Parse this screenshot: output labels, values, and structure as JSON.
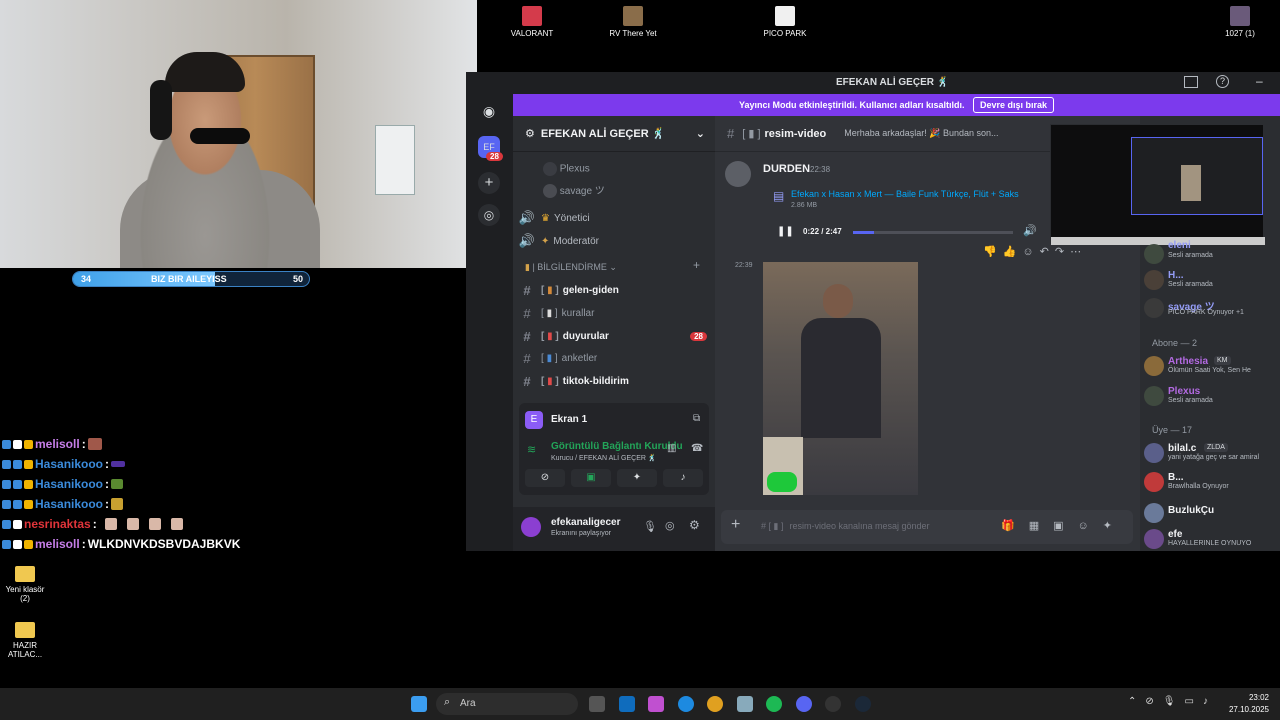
{
  "webcam": {
    "progress": {
      "left": "34",
      "label": "BIZ BIR AILEYISS",
      "right": "50",
      "fill": 0.6
    }
  },
  "desktop_icons_top": [
    {
      "label": "VALORANT",
      "color": "#d43b4b"
    },
    {
      "label": "RV There Yet",
      "color": "#8a6d4a"
    },
    {
      "label": "PICO PARK",
      "color": "#f0f0f0"
    },
    {
      "label": "1027 (1)",
      "color": "#6a5a7a"
    }
  ],
  "desktop_icons_left": [
    {
      "label": "Yeni klasör (2)"
    },
    {
      "label": "HAZIR ATILAC..."
    }
  ],
  "chat_overlay": [
    {
      "user": "melisoll",
      "text": "",
      "color": "#c67ee8"
    },
    {
      "user": "Hasanikooo",
      "text": "",
      "color": "#3b8bdb"
    },
    {
      "user": "Hasanikooo",
      "text": "",
      "color": "#3b8bdb"
    },
    {
      "user": "Hasanikooo",
      "text": "",
      "color": "#3b8bdb"
    },
    {
      "user": "nesrinaktas",
      "text": "",
      "color": "#e0343a"
    },
    {
      "user": "melisoll",
      "text": "WLKDNVKDSBVDAJBKVK",
      "color": "#c67ee8"
    }
  ],
  "discord": {
    "window_title": "EFEKAN ALİ GEÇER 🕺",
    "server_badge": "28",
    "streamer_mode": {
      "text": "Yayıncı Modu etkinleştirildi. Kullanıcı adları kısaltıldı.",
      "button": "Devre dışı bırak"
    },
    "server_name": "EFEKAN ALİ GEÇER 🕺",
    "voice_users": [
      "Plexus",
      "savage ツ"
    ],
    "categories": [
      {
        "label": "Yönetici"
      },
      {
        "label": "Moderatör"
      }
    ],
    "info_category": "| BİLGİLENDİRME",
    "channels": [
      {
        "label": "gelen-giden",
        "bold": true,
        "badge": ""
      },
      {
        "label": "kurallar",
        "bold": false,
        "badge": ""
      },
      {
        "label": "duyurular",
        "bold": true,
        "badge": "28"
      },
      {
        "label": "anketler",
        "bold": false,
        "badge": ""
      },
      {
        "label": "tiktok-bildirim",
        "bold": true,
        "badge": ""
      }
    ],
    "screen_panel": {
      "title": "Ekran 1",
      "status": "Görüntülü Bağlantı Kuruldu",
      "sub": "Kurucu / EFEKAN ALİ GEÇER 🕺"
    },
    "user": {
      "name": "efekanaligecer",
      "status": "Ekranını paylaşıyor"
    },
    "channel_header": {
      "name": "resim-video",
      "topic": "Merhaba arkadaşlar! 🎉 Bundan son..."
    },
    "messages": {
      "author": "DURDEN",
      "time": "22:38",
      "file_name": "Efekan x Hasan x Mert — Baile Funk Türkçe, Flüt + Saks",
      "file_size": "2.86 MB",
      "audio_time": "0:22 / 2:47",
      "audio_progress": 0.13,
      "second_time": "22:39"
    },
    "composer_placeholder": "resim-video kanalına mesaj gönder",
    "members": [
      {
        "name": "eleni",
        "sub": "Sesli aramada",
        "color": "#949cf7",
        "section": ""
      },
      {
        "name": "H...",
        "sub": "Sesli aramada",
        "color": "#949cf7",
        "section": ""
      },
      {
        "name": "savage ツ",
        "sub": "PICO PARK Oynuyor +1",
        "color": "#949cf7",
        "section": ""
      },
      {
        "name": "Arthesia",
        "sub": "Ölümün Saati Yok, Sen He",
        "color": "#b36ae2",
        "section": "Abone — 2"
      },
      {
        "name": "Plexus",
        "sub": "Sesli aramada",
        "color": "#b36ae2",
        "section": ""
      },
      {
        "name": "bilal.c",
        "sub": "yani yatağa geç ve sar amiral",
        "color": "#f2f3f5",
        "section": "Üye — 17"
      },
      {
        "name": "B...",
        "sub": "Brawlhalla Oynuyor",
        "color": "#f2f3f5",
        "section": ""
      },
      {
        "name": "BuzlukÇu",
        "sub": "",
        "color": "#f2f3f5",
        "section": ""
      },
      {
        "name": "efe",
        "sub": "HAYALLERINLE OYNUYO",
        "color": "#f2f3f5",
        "section": ""
      }
    ],
    "member_tag": "ZLDA",
    "arthesia_tag": "KM"
  },
  "taskbar": {
    "search_placeholder": "Ara",
    "time": "23:02",
    "date": "27.10.2025"
  }
}
